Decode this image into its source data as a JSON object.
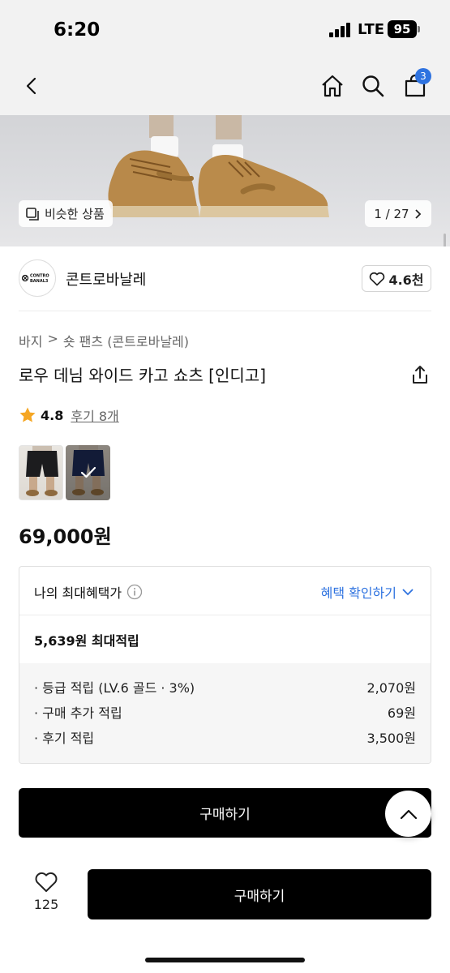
{
  "status_bar": {
    "time": "6:20",
    "network": "LTE",
    "battery": "95"
  },
  "nav": {
    "back_icon": "chevron-left-icon",
    "home_icon": "home-icon",
    "search_icon": "search-icon",
    "cart_icon": "shopping-bag-icon",
    "cart_count": "3"
  },
  "hero": {
    "similar_label": "비슷한 상품",
    "counter": "1 / 27"
  },
  "brand": {
    "logo_text_1": "CONTRO",
    "logo_text_2": "BANAL3",
    "name": "콘트로바날레",
    "likes": "4.6천"
  },
  "product": {
    "breadcrumb": [
      "바지",
      "숏 팬츠 (콘트로바날레)"
    ],
    "title": "로우 데님 와이드 카고 쇼츠 [인디고]",
    "rating": "4.8",
    "reviews": "후기 8개",
    "price": "69,000원"
  },
  "benefit": {
    "label": "나의 최대혜택가",
    "link": "혜택 확인하기",
    "total_points": "5,639원 최대적립",
    "items": [
      {
        "label": "· 등급 적립 (LV.6 골드 · 3%)",
        "value": "2,070원"
      },
      {
        "label": "· 구매 추가 적립",
        "value": "69원"
      },
      {
        "label": "· 후기 적립",
        "value": "3,500원"
      }
    ]
  },
  "buttons": {
    "buy_main": "구매하기",
    "buy_bottom": "구매하기",
    "wish_count": "125"
  },
  "colors": {
    "accent": "#2f73e0",
    "star": "#f5a623",
    "button": "#000000"
  }
}
